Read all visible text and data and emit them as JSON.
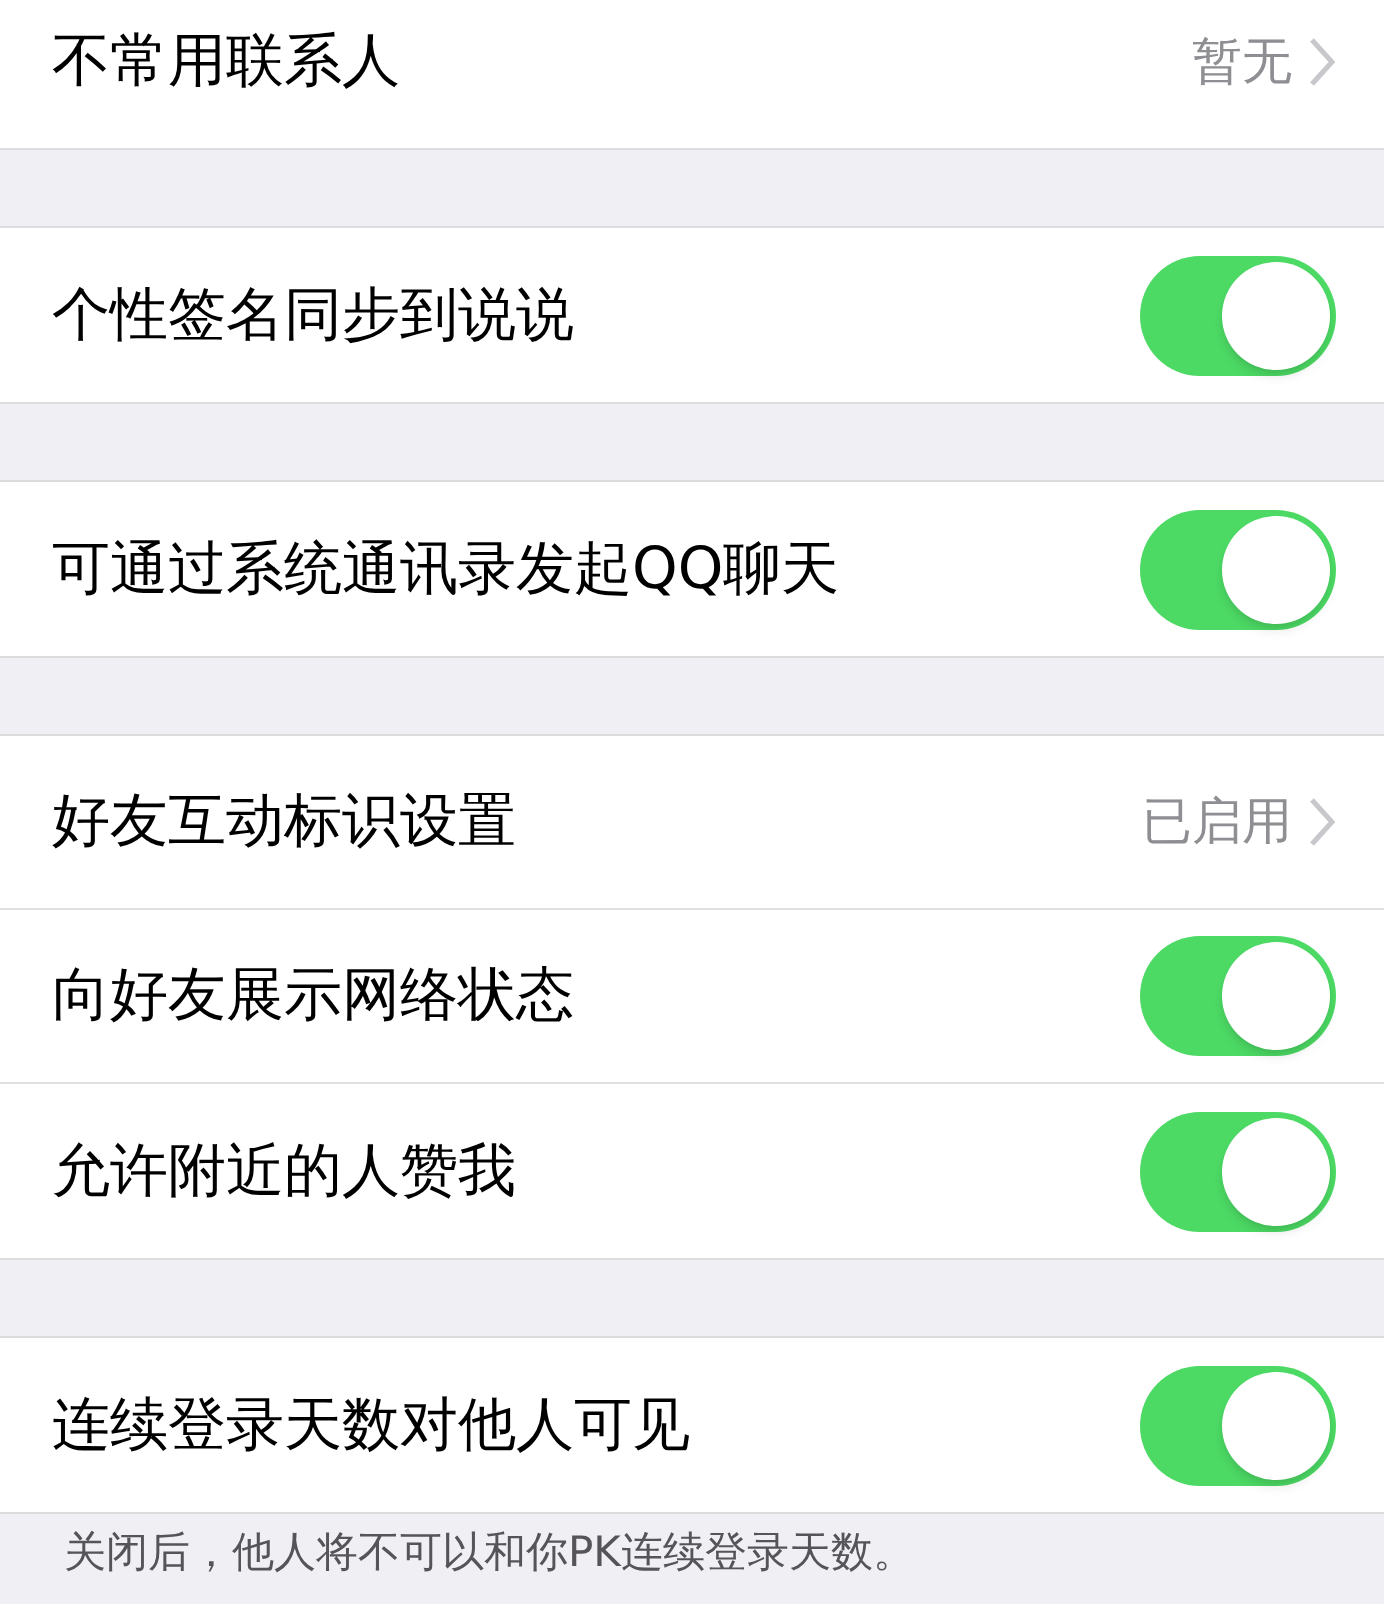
{
  "groups": [
    {
      "rows": [
        {
          "kind": "value",
          "label": "不常用联系人",
          "value": "暂无"
        }
      ]
    },
    {
      "rows": [
        {
          "kind": "toggle",
          "label": "个性签名同步到说说",
          "on": true
        }
      ]
    },
    {
      "rows": [
        {
          "kind": "toggle",
          "label": "可通过系统通讯录发起QQ聊天",
          "on": true
        }
      ]
    },
    {
      "rows": [
        {
          "kind": "value",
          "label": "好友互动标识设置",
          "value": "已启用"
        },
        {
          "kind": "toggle",
          "label": "向好友展示网络状态",
          "on": true
        },
        {
          "kind": "toggle",
          "label": "允许附近的人赞我",
          "on": true
        }
      ]
    },
    {
      "rows": [
        {
          "kind": "toggle",
          "label": "连续登录天数对他人可见",
          "on": true
        }
      ]
    }
  ],
  "footer": "关闭后，他人将不可以和你PK连续登录天数。"
}
